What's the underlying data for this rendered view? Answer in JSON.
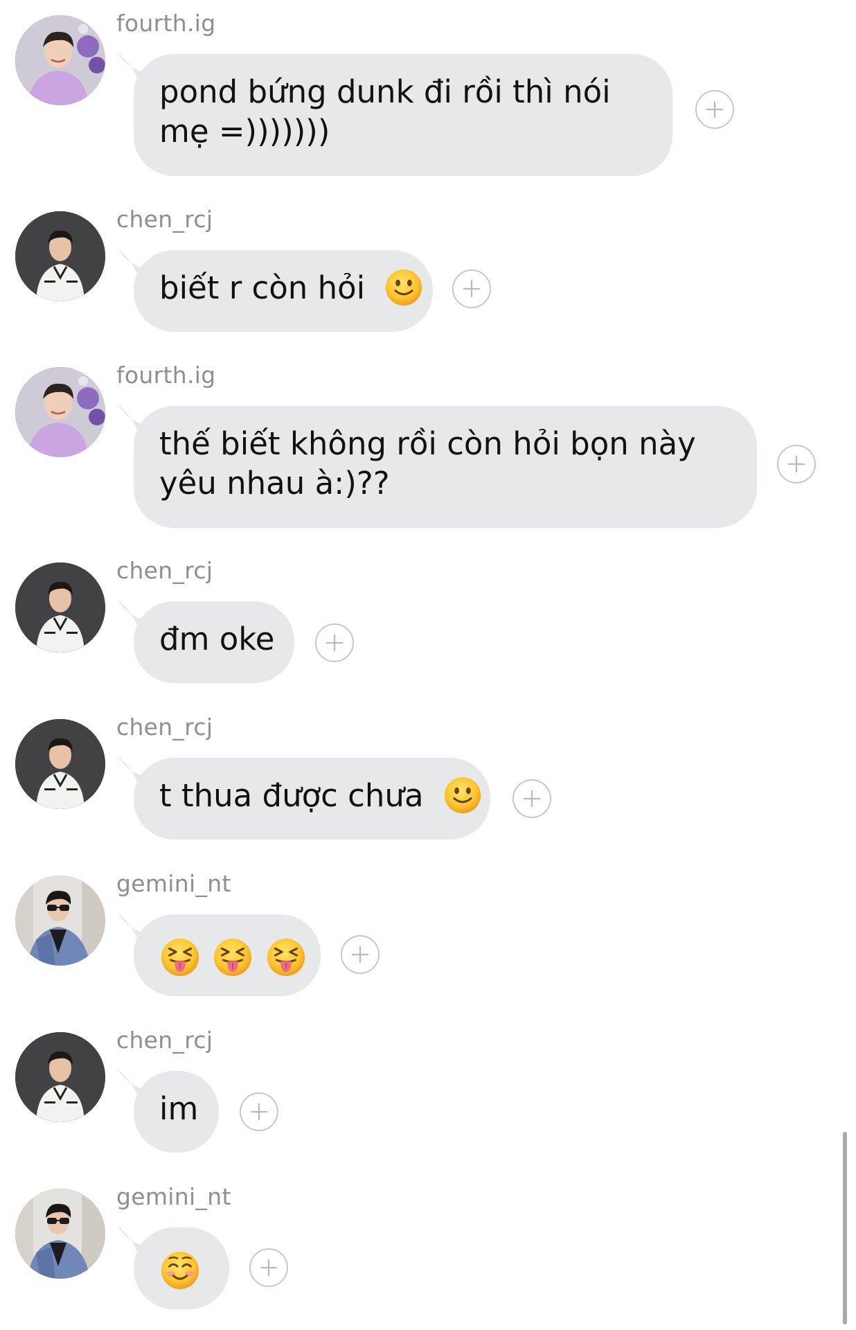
{
  "messages": [
    {
      "username": "fourth.ig",
      "avatar": "avatar-fourth",
      "text": "pond bứng dunk đi rồi thì nói mẹ =)))))))",
      "emoji": null
    },
    {
      "username": "chen_rcj",
      "avatar": "avatar-chen",
      "text": "biết r còn hỏi",
      "emoji": "slightly-smiling-face"
    },
    {
      "username": "fourth.ig",
      "avatar": "avatar-fourth",
      "text": "thế biết không rồi còn hỏi bọn này yêu nhau à:)??",
      "emoji": null
    },
    {
      "username": "chen_rcj",
      "avatar": "avatar-chen",
      "text": "đm oke",
      "emoji": null
    },
    {
      "username": "chen_rcj",
      "avatar": "avatar-chen",
      "text": "t thua được chưa",
      "emoji": "slightly-smiling-face"
    },
    {
      "username": "gemini_nt",
      "avatar": "avatar-gemini",
      "text": "",
      "emoji": "squinting-face-with-tongue x3"
    },
    {
      "username": "chen_rcj",
      "avatar": "avatar-chen",
      "text": "im",
      "emoji": null
    },
    {
      "username": "gemini_nt",
      "avatar": "avatar-gemini",
      "text": "",
      "emoji": "smiling-face"
    }
  ],
  "icons": {
    "reaction": "add-reaction-icon"
  },
  "colors": {
    "bubble": "#e6e8ea",
    "username": "#8e8e93",
    "reaction_border": "#c7c7cc"
  }
}
